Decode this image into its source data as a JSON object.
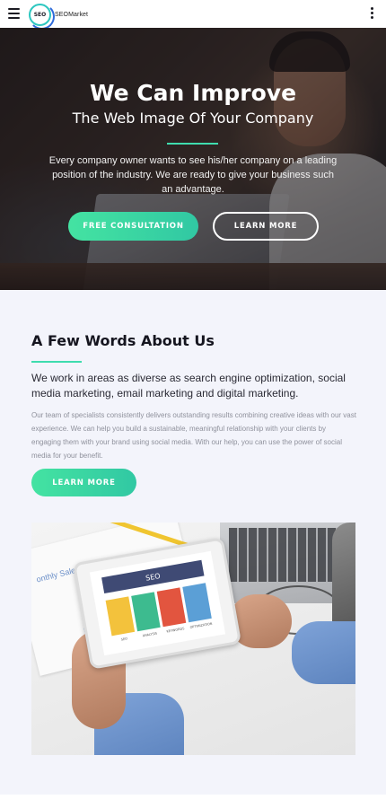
{
  "header": {
    "logo_badge": "SEO",
    "logo_text": "SEOMarket",
    "icons": [
      "hamburger-menu-icon",
      "more-vertical-icon"
    ]
  },
  "hero": {
    "title": "We Can Improve",
    "subtitle": "The Web Image Of Your Company",
    "description": "Every company owner wants to see his/her company on a leading position of the industry. We are ready to give your business such an advantage.",
    "primary_button": "FREE CONSULTATION",
    "secondary_button": "LEARN MORE"
  },
  "about": {
    "title": "A Few Words About Us",
    "lead": "We work in areas as diverse as search engine optimization, social media marketing, email marketing and digital marketing.",
    "body": "Our team of specialists consistently delivers outstanding results combining creative ideas with our vast experience. We can help you build a sustainable, meaningful relationship with your clients by engaging them with your brand using social media. With our help, you can use the power of social media for your benefit.",
    "button": "LEARN MORE"
  },
  "photo": {
    "paper_text": "onthly Sales",
    "tablet_header": "SEO",
    "tile_captions": [
      "SEO",
      "ANALYSIS",
      "KEYWORDS",
      "OPTIMIZATION"
    ],
    "tile_colors": [
      "#f3c23c",
      "#3dbb8f",
      "#e2553f",
      "#5b9fd6"
    ]
  },
  "colors": {
    "accent": "#3fdcae",
    "hero_dark": "#2a211d",
    "page_bg": "#f3f4fb",
    "title": "#15151f"
  }
}
